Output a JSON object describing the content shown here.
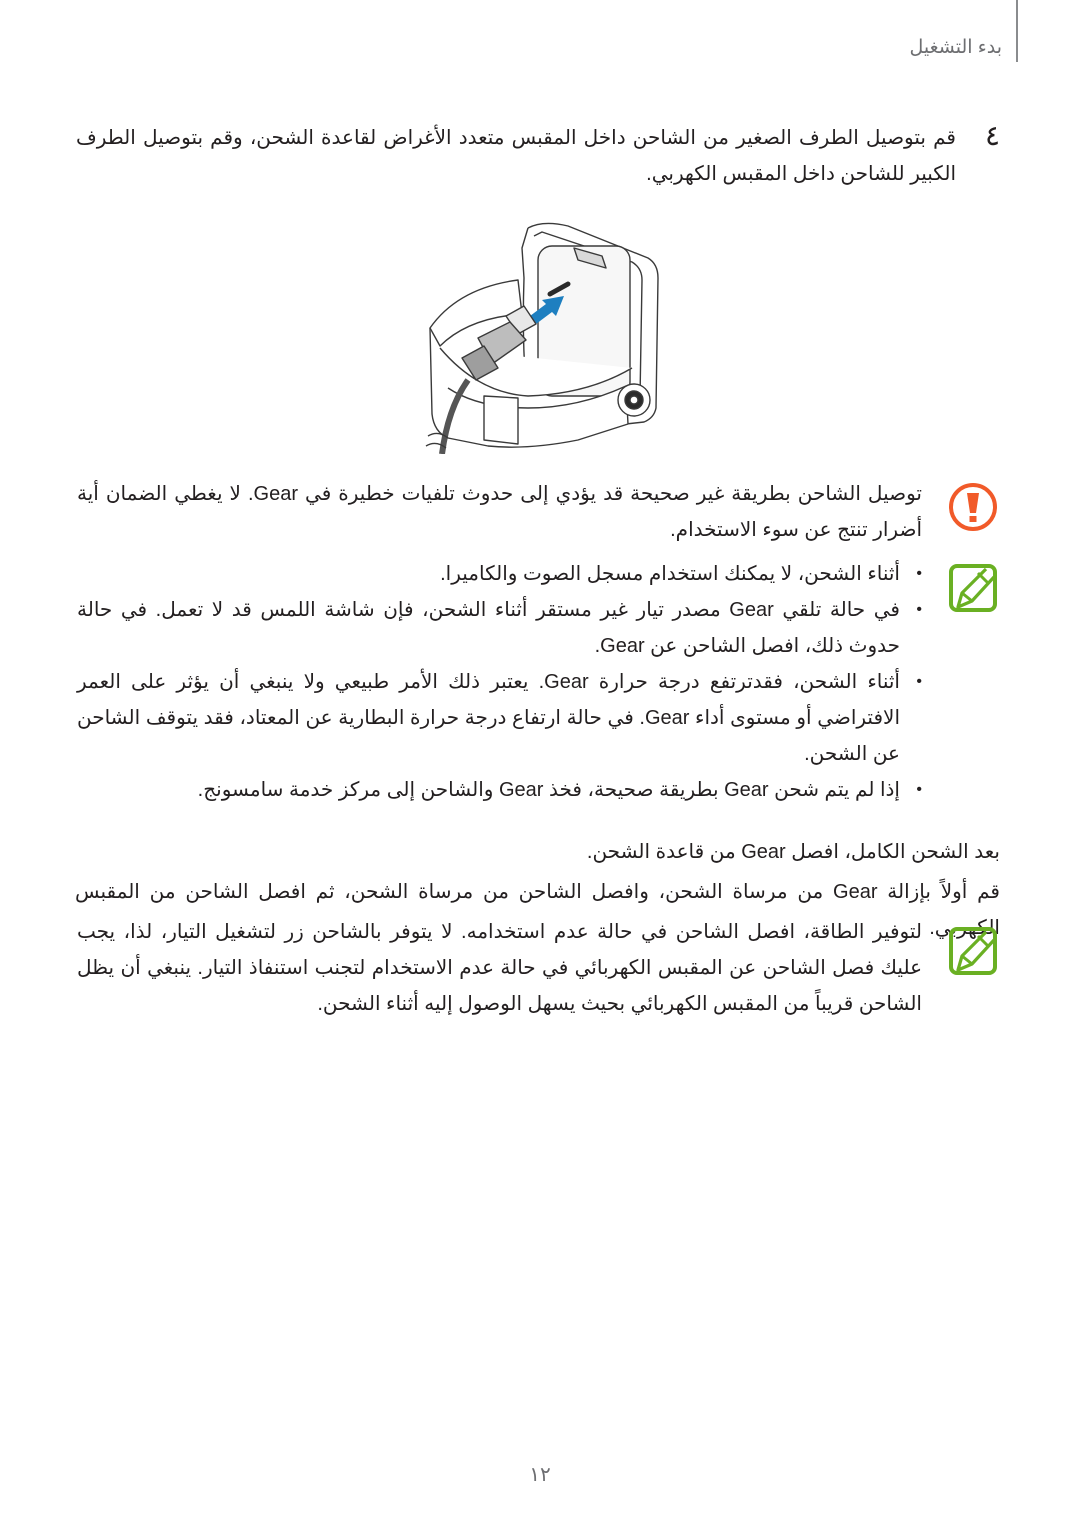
{
  "header": {
    "section_title": "بدء التشغيل"
  },
  "step": {
    "number": "٤",
    "text": "قم بتوصيل الطرف الصغير من الشاحن داخل المقبس متعدد الأغراض لقاعدة الشحن، وقم بتوصيل الطرف الكبير للشاحن داخل المقبس الكهربي."
  },
  "illustration": {
    "description": "Charger cable plugged into the charging dock of the Gear",
    "arrow_color": "#1e7fc0"
  },
  "warning": {
    "icon": "warning-exclamation-icon",
    "color": "#f15a29",
    "text": "توصيل الشاحن بطريقة غير صحيحة قد يؤدي إلى حدوث تلفيات خطيرة في Gear. لا يغطي الضمان أية أضرار تنتج عن سوء الاستخدام."
  },
  "note1": {
    "icon": "note-pencil-icon",
    "color": "#6ab023",
    "bullets": [
      "أثناء الشحن، لا يمكنك استخدام مسجل الصوت والكاميرا.",
      "في حالة تلقي Gear مصدر تيار غير مستقر أثناء الشحن، فإن شاشة اللمس قد لا تعمل. في حالة حدوث ذلك، افصل الشاحن عن Gear.",
      "أثناء الشحن، فقدترتفع درجة حرارة Gear. يعتبر ذلك الأمر طبيعي ولا ينبغي أن يؤثر على العمر الافتراضي أو مستوى أداء Gear. في حالة ارتفاع درجة حرارة البطارية عن المعتاد، فقد يتوقف الشاحن عن الشحن.",
      "إذا لم يتم شحن Gear بطريقة صحيحة، فخذ Gear والشاحن إلى مركز خدمة سامسونج."
    ]
  },
  "after_charge": {
    "line1": "بعد الشحن الكامل، افصل Gear من قاعدة الشحن.",
    "line2": "قم أولاً بإزالة Gear من مرساة الشحن، وافصل الشاحن من مرساة الشحن، ثم افصل الشاحن من المقبس الكهربي."
  },
  "note2": {
    "icon": "note-pencil-icon",
    "color": "#6ab023",
    "text": "لتوفير الطاقة، افصل الشاحن في حالة عدم استخدامه. لا يتوفر بالشاحن زر لتشغيل التيار، لذا، يجب عليك فصل الشاحن عن المقبس الكهربائي في حالة عدم الاستخدام لتجنب استنفاذ التيار. ينبغي أن يظل الشاحن قريباً من المقبس الكهربائي بحيث يسهل الوصول إليه أثناء الشحن."
  },
  "footer": {
    "page_number": "١٢"
  }
}
